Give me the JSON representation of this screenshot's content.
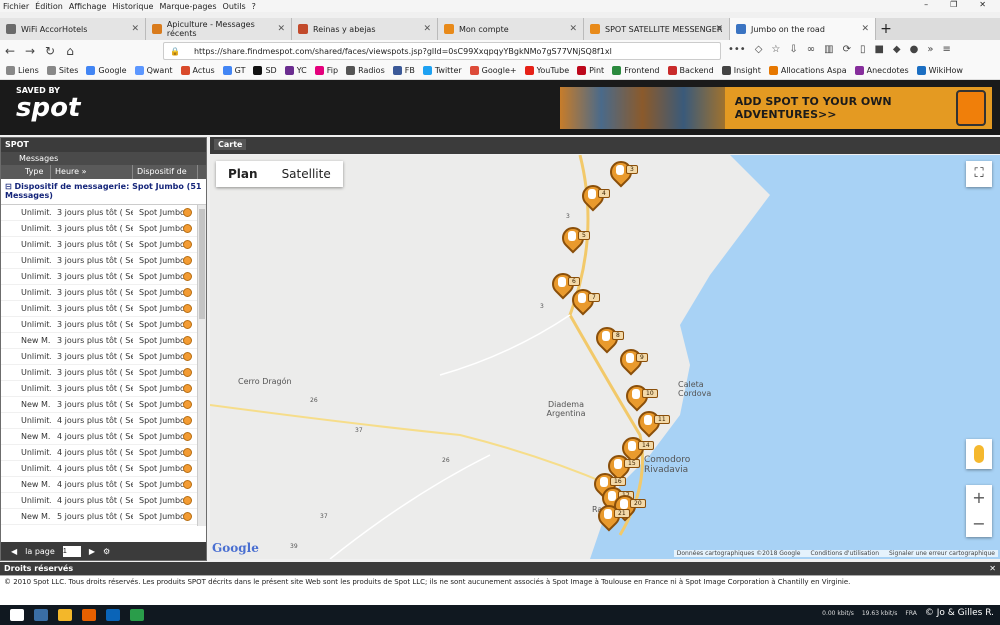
{
  "menu": [
    "Fichier",
    "Édition",
    "Affichage",
    "Historique",
    "Marque-pages",
    "Outils",
    "?"
  ],
  "tabs": [
    {
      "label": "WiFi AccorHotels",
      "color": "#6a6a6a"
    },
    {
      "label": "Apiculture - Messages récents",
      "color": "#d97b1c"
    },
    {
      "label": "Reinas y abejas",
      "color": "#c24a2b"
    },
    {
      "label": "Mon compte",
      "color": "#e88a1a"
    },
    {
      "label": "SPOT SATELLITE MESSENGER",
      "color": "#e88a1a"
    },
    {
      "label": "Jumbo on the road",
      "color": "#3b74c2"
    }
  ],
  "url": "https://share.findmespot.com/shared/faces/viewspots.jsp?glId=0sC99XxqpqyYBgkNMo7gS77VNjSQ8f1xl",
  "bookmarks": [
    {
      "label": "Liens",
      "color": "#888"
    },
    {
      "label": "Sites",
      "color": "#888"
    },
    {
      "label": "Google",
      "color": "#4285f4"
    },
    {
      "label": "Qwant",
      "color": "#5c97ff"
    },
    {
      "label": "Actus",
      "color": "#d94a2b"
    },
    {
      "label": "GT",
      "color": "#4285f4"
    },
    {
      "label": "SD",
      "color": "#111"
    },
    {
      "label": "YC",
      "color": "#6b2d90"
    },
    {
      "label": "Fip",
      "color": "#e4007c"
    },
    {
      "label": "Radios",
      "color": "#555"
    },
    {
      "label": "FB",
      "color": "#3b5998"
    },
    {
      "label": "Twitter",
      "color": "#1da1f2"
    },
    {
      "label": "Google+",
      "color": "#dd4b39"
    },
    {
      "label": "YouTube",
      "color": "#e62117"
    },
    {
      "label": "Pint",
      "color": "#bd081c"
    },
    {
      "label": "Frontend",
      "color": "#2b8a3e"
    },
    {
      "label": "Backend",
      "color": "#c92a2a"
    },
    {
      "label": "Insight",
      "color": "#444"
    },
    {
      "label": "Allocations Aspa",
      "color": "#e67700"
    },
    {
      "label": "Anecdotes",
      "color": "#862e9c"
    },
    {
      "label": "WikiHow",
      "color": "#1b6ec2"
    }
  ],
  "header": {
    "saved_by": "SAVED BY",
    "brand": "spot",
    "ad_text": "ADD SPOT TO YOUR OWN ADVENTURES>>"
  },
  "panel": {
    "title": "SPOT",
    "sub": "Messages",
    "columns": [
      "Type",
      "Heure »",
      "Dispositif de"
    ],
    "group": "Dispositif de messagerie: Spot Jumbo (51 Messages)",
    "rows": [
      {
        "type": "Unlimit...",
        "time": "3 jours plus tôt ( Sep...",
        "device": "Spot Jumbo"
      },
      {
        "type": "Unlimit...",
        "time": "3 jours plus tôt ( Sep...",
        "device": "Spot Jumbo"
      },
      {
        "type": "Unlimit...",
        "time": "3 jours plus tôt ( Sep...",
        "device": "Spot Jumbo"
      },
      {
        "type": "Unlimit...",
        "time": "3 jours plus tôt ( Sep...",
        "device": "Spot Jumbo"
      },
      {
        "type": "Unlimit...",
        "time": "3 jours plus tôt ( Sep...",
        "device": "Spot Jumbo"
      },
      {
        "type": "Unlimit...",
        "time": "3 jours plus tôt ( Sep...",
        "device": "Spot Jumbo"
      },
      {
        "type": "Unlimit...",
        "time": "3 jours plus tôt ( Sep...",
        "device": "Spot Jumbo"
      },
      {
        "type": "Unlimit...",
        "time": "3 jours plus tôt ( Sep...",
        "device": "Spot Jumbo"
      },
      {
        "type": "New M...",
        "time": "3 jours plus tôt ( Sep...",
        "device": "Spot Jumbo"
      },
      {
        "type": "Unlimit...",
        "time": "3 jours plus tôt ( Sep...",
        "device": "Spot Jumbo"
      },
      {
        "type": "Unlimit...",
        "time": "3 jours plus tôt ( Sep...",
        "device": "Spot Jumbo"
      },
      {
        "type": "Unlimit...",
        "time": "3 jours plus tôt ( Sep...",
        "device": "Spot Jumbo"
      },
      {
        "type": "New M...",
        "time": "3 jours plus tôt ( Sep...",
        "device": "Spot Jumbo"
      },
      {
        "type": "Unlimit...",
        "time": "4 jours plus tôt ( Sep...",
        "device": "Spot Jumbo"
      },
      {
        "type": "New M...",
        "time": "4 jours plus tôt ( Sep...",
        "device": "Spot Jumbo"
      },
      {
        "type": "Unlimit...",
        "time": "4 jours plus tôt ( Sep...",
        "device": "Spot Jumbo"
      },
      {
        "type": "Unlimit...",
        "time": "4 jours plus tôt ( Sep...",
        "device": "Spot Jumbo"
      },
      {
        "type": "New M...",
        "time": "4 jours plus tôt ( Sep...",
        "device": "Spot Jumbo"
      },
      {
        "type": "Unlimit...",
        "time": "4 jours plus tôt ( Sep...",
        "device": "Spot Jumbo"
      },
      {
        "type": "New M...",
        "time": "5 jours plus tôt ( Sep...",
        "device": "Spot Jumbo"
      },
      {
        "type": "Unlimit...",
        "time": "6 jours plus tôt ( Sep...",
        "device": "Spot Jumbo"
      },
      {
        "type": "Unlimit...",
        "time": "6 jours plus tôt ( Sep...",
        "device": "Spot Jumbo"
      }
    ],
    "pager_label": "la page",
    "pager_value": "1"
  },
  "map": {
    "tab": "Carte",
    "plan": "Plan",
    "satellite": "Satellite",
    "places": [
      "Cerro Dragón",
      "Diadema Argentina",
      "Caleta Cordova",
      "Comodoro Rivadavia",
      "Rada Tilly"
    ],
    "road_labels": [
      "3",
      "26",
      "37",
      "26",
      "37",
      "39",
      "3"
    ],
    "pin_labels": [
      "3",
      "4",
      "5",
      "6",
      "7",
      "8",
      "9",
      "10",
      "11",
      "14",
      "15",
      "16",
      "17",
      "20",
      "21"
    ],
    "attribution": [
      "Données cartographiques ©2018 Google",
      "Conditions d'utilisation",
      "Signaler une erreur cartographique"
    ],
    "google": "Google",
    "water_color": "#a8d2f5",
    "land_color": "#ececeb"
  },
  "footer": {
    "droits": "Droits réservés",
    "text": "© 2010 Spot LLC. Tous droits réservés. Les produits SPOT décrits dans le présent site Web sont les produits de Spot LLC; ils ne sont aucunement associés à Spot Image à Toulouse en France ni à Spot Image Corporation à Chantilly en Virginie."
  },
  "watermark": "© Jo & Gilles R.",
  "taskbar": {
    "net_up": "0.00 kbit/s",
    "net_down": "19.63 kbit/s",
    "lang": "FRA"
  }
}
